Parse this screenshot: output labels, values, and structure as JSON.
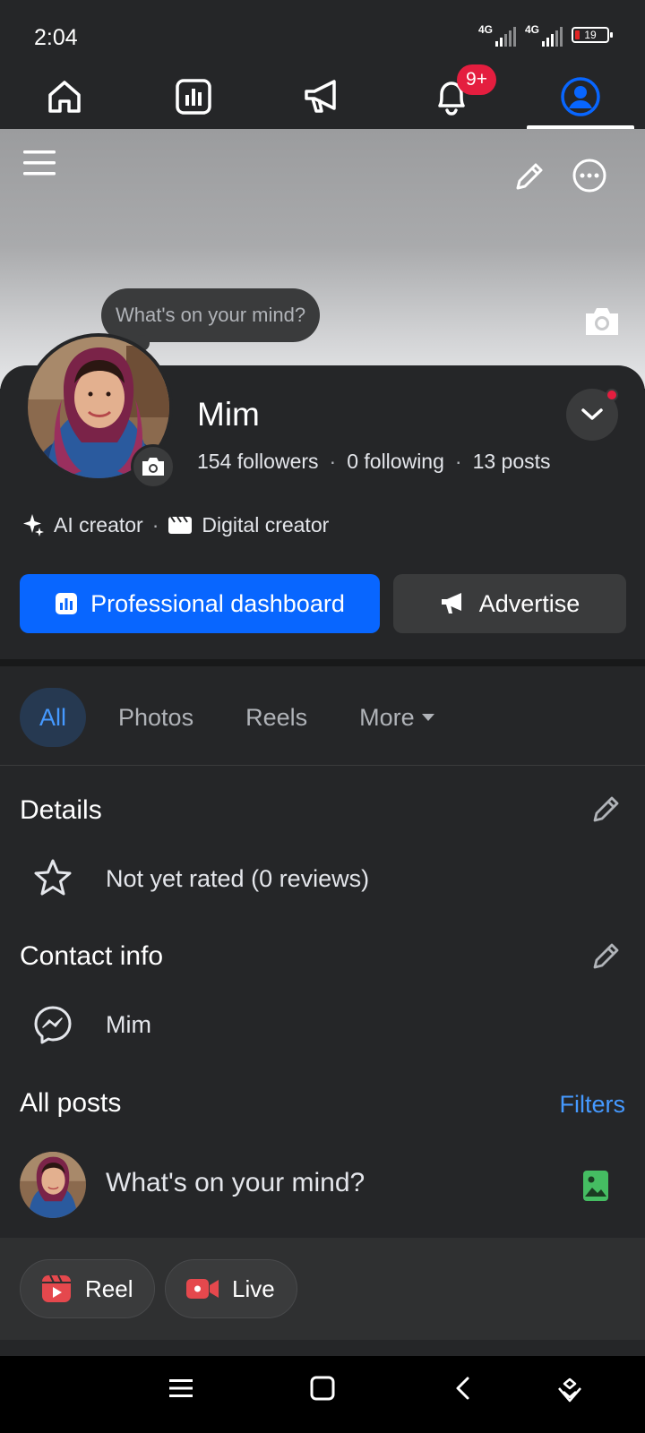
{
  "status_bar": {
    "time": "2:04",
    "network_1": "4G",
    "network_2": "4G",
    "battery": "19"
  },
  "top_nav": {
    "tabs": [
      {
        "icon": "home-icon"
      },
      {
        "icon": "dashboard-icon"
      },
      {
        "icon": "megaphone-icon"
      },
      {
        "icon": "bell-icon",
        "badge": "9+"
      },
      {
        "icon": "profile-icon",
        "active": true
      }
    ]
  },
  "cover": {
    "status_prompt": "What's on your mind?"
  },
  "profile": {
    "name": "Mim",
    "followers": "154 followers",
    "following": "0 following",
    "posts": "13 posts",
    "categories": [
      "AI creator",
      "Digital creator"
    ],
    "primary_button": "Professional dashboard",
    "secondary_button": "Advertise"
  },
  "filter_tabs": {
    "items": [
      "All",
      "Photos",
      "Reels",
      "More"
    ],
    "active": "All"
  },
  "details": {
    "title": "Details",
    "rating_text": "Not yet rated (0 reviews)"
  },
  "contact_info": {
    "title": "Contact info",
    "messenger": "Mim"
  },
  "all_posts": {
    "title": "All posts",
    "filters_label": "Filters",
    "composer_placeholder": "What's on your mind?"
  },
  "post_actions": {
    "reel_label": "Reel",
    "live_label": "Live"
  },
  "colors": {
    "background": "#252628",
    "accent_blue": "#0866ff",
    "link_blue": "#4599ff",
    "badge_red": "#e41e3f"
  }
}
